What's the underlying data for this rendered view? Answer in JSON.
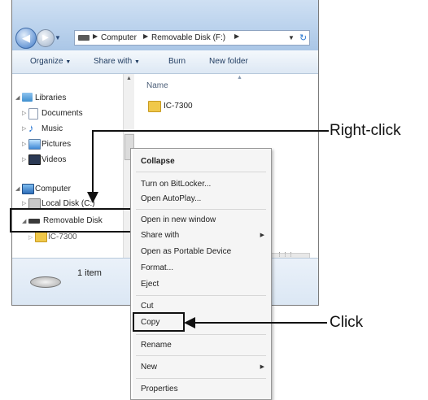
{
  "breadcrumb": [
    "Computer",
    "Removable Disk (F:)"
  ],
  "toolbar": {
    "organize": "Organize",
    "share_with": "Share with",
    "burn": "Burn",
    "new_folder": "New folder"
  },
  "navpane": {
    "libraries": "Libraries",
    "documents": "Documents",
    "music": "Music",
    "pictures": "Pictures",
    "videos": "Videos",
    "computer": "Computer",
    "local_disk": "Local Disk (C:)",
    "removable_disk": "Removable Disk",
    "ic7300": "IC-7300"
  },
  "content": {
    "column_name": "Name",
    "folder": "IC-7300"
  },
  "status": {
    "item_count": "1 item"
  },
  "menu": {
    "collapse": "Collapse",
    "bitlocker": "Turn on BitLocker...",
    "autoplay": "Open AutoPlay...",
    "open_new_window": "Open in new window",
    "share_with": "Share with",
    "open_portable": "Open as Portable Device",
    "format": "Format...",
    "eject": "Eject",
    "cut": "Cut",
    "copy": "Copy",
    "rename": "Rename",
    "new": "New",
    "properties": "Properties"
  },
  "callouts": {
    "right_click": "Right-click",
    "click": "Click"
  },
  "colors": {
    "accent": "#3c6aab",
    "window_chrome": "#b9d1ec"
  }
}
